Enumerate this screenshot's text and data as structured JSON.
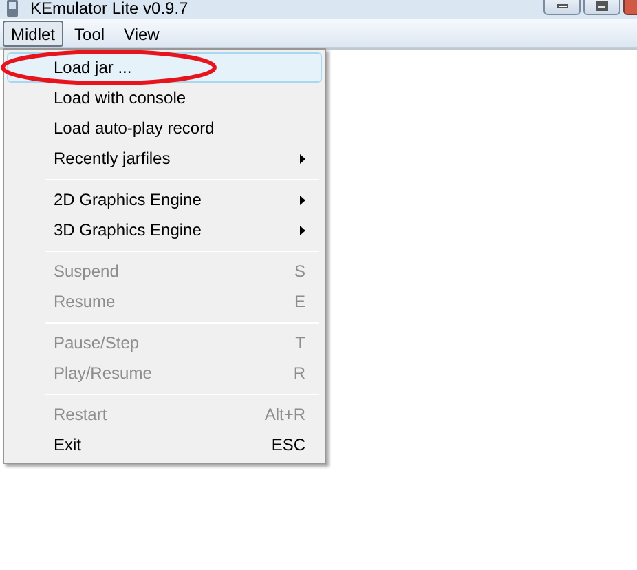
{
  "window": {
    "title": "KEmulator Lite v0.9.7"
  },
  "menu_bar": [
    {
      "label": "Midlet",
      "selected": true
    },
    {
      "label": "Tool",
      "selected": false
    },
    {
      "label": "View",
      "selected": false
    }
  ],
  "menu": [
    {
      "kind": "item",
      "label": "Load jar ...",
      "selected": true,
      "disabled": false
    },
    {
      "kind": "item",
      "label": "Load with console",
      "selected": false,
      "disabled": false
    },
    {
      "kind": "item",
      "label": "Load auto-play record",
      "selected": false,
      "disabled": false
    },
    {
      "kind": "submenu",
      "label": "Recently jarfiles",
      "selected": false,
      "disabled": false
    },
    {
      "kind": "separator"
    },
    {
      "kind": "submenu",
      "label": "2D Graphics Engine",
      "selected": false,
      "disabled": false
    },
    {
      "kind": "submenu",
      "label": "3D Graphics Engine",
      "selected": false,
      "disabled": false
    },
    {
      "kind": "separator"
    },
    {
      "kind": "item",
      "label": "Suspend",
      "shortcut": "S",
      "selected": false,
      "disabled": true
    },
    {
      "kind": "item",
      "label": "Resume",
      "shortcut": "E",
      "selected": false,
      "disabled": true
    },
    {
      "kind": "separator"
    },
    {
      "kind": "item",
      "label": "Pause/Step",
      "shortcut": "T",
      "selected": false,
      "disabled": true
    },
    {
      "kind": "item",
      "label": "Play/Resume",
      "shortcut": "R",
      "selected": false,
      "disabled": true
    },
    {
      "kind": "separator"
    },
    {
      "kind": "item",
      "label": "Restart",
      "shortcut": "Alt+R",
      "selected": false,
      "disabled": true
    },
    {
      "kind": "item",
      "label": "Exit",
      "shortcut": "ESC",
      "selected": false,
      "disabled": false
    }
  ]
}
